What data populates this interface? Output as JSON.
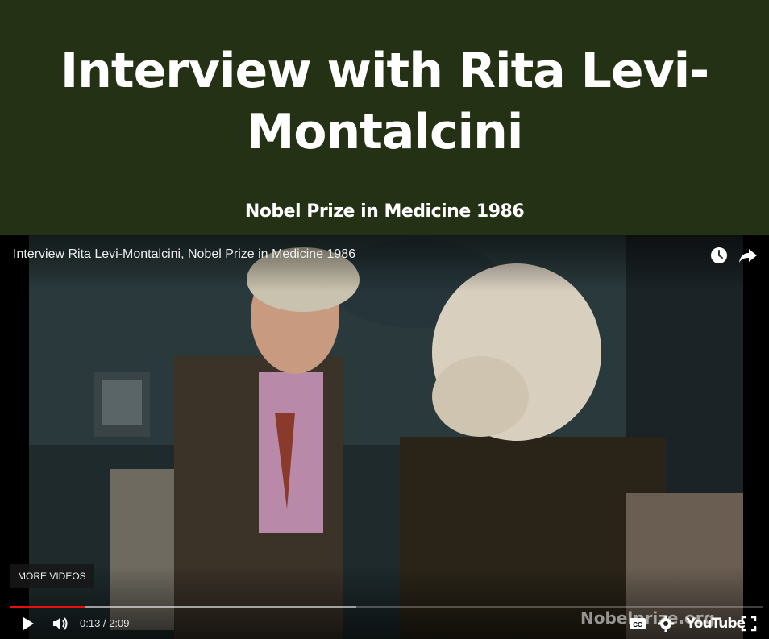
{
  "header": {
    "title": "Interview with Rita Levi-Montalcini",
    "subtitle": "Nobel Prize in Medicine 1986"
  },
  "player": {
    "video_title": "Interview Rita Levi-Montalcini, Nobel Prize in Medicine 1986",
    "more_videos_label": "MORE VIDEOS",
    "current_time": "0:13",
    "duration": "2:09",
    "time_display": "0:13 / 2:09",
    "played_fraction": 0.1,
    "buffered_fraction": 0.46,
    "watermark_text": "Nobelprize.org",
    "logo_text": "YouTube",
    "icons": {
      "watch_later": "clock-icon",
      "share": "share-arrow-icon",
      "play": "play-icon",
      "volume": "volume-icon",
      "captions": "cc-icon",
      "settings": "gear-icon",
      "fullscreen": "fullscreen-icon"
    },
    "colors": {
      "progress_played": "#e5100e",
      "header_background": "#243115"
    }
  }
}
